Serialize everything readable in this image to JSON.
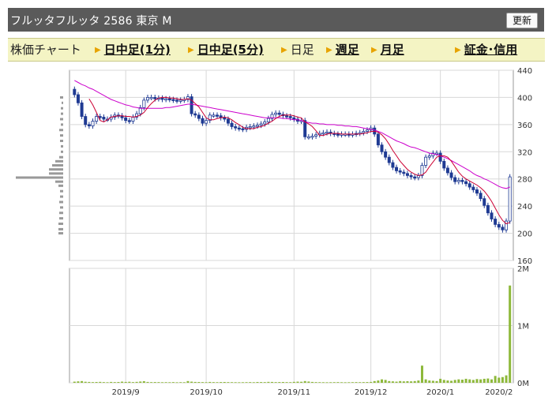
{
  "header": {
    "title": "フルッタフルッタ  2586  東京 M",
    "refresh_label": "更新"
  },
  "tabs": [
    {
      "label": "株価チャート",
      "link": false,
      "arrow": false
    },
    {
      "label": "日中足(1分)",
      "link": true,
      "arrow": true
    },
    {
      "label": "日中足(5分)",
      "link": true,
      "arrow": true
    },
    {
      "label": "日足",
      "link": false,
      "arrow": true
    },
    {
      "label": "週足",
      "link": true,
      "arrow": true
    },
    {
      "label": "月足",
      "link": true,
      "arrow": true
    },
    {
      "label": "証金･信用",
      "link": true,
      "arrow": true
    }
  ],
  "colors": {
    "header_bg": "#5a5a5a",
    "tab_bg": "#f4f4c4",
    "candle": "#1f3a93",
    "ma_short": "#cc0033",
    "ma_long": "#cc00cc",
    "volume": "#8db83a",
    "volume_profile": "#999999"
  },
  "chart_data": [
    {
      "type": "candlestick",
      "title": "",
      "ylim": [
        160,
        440
      ],
      "yticks": [
        160,
        200,
        240,
        280,
        320,
        360,
        400,
        440
      ],
      "x_labels": [
        "2019/9",
        "2019/10",
        "2019/11",
        "2019/12",
        "2020/1",
        "2020/2"
      ],
      "grid": true,
      "close": [
        404,
        392,
        372,
        360,
        358,
        365,
        372,
        371,
        368,
        368,
        371,
        374,
        373,
        370,
        366,
        365,
        371,
        376,
        385,
        396,
        400,
        400,
        398,
        399,
        397,
        398,
        397,
        396,
        395,
        396,
        397,
        401,
        376,
        374,
        369,
        362,
        366,
        374,
        374,
        373,
        370,
        368,
        362,
        357,
        355,
        354,
        353,
        356,
        357,
        358,
        359,
        361,
        364,
        369,
        375,
        377,
        375,
        373,
        372,
        370,
        368,
        365,
        366,
        342,
        342,
        343,
        345,
        347,
        348,
        349,
        347,
        346,
        345,
        346,
        346,
        345,
        346,
        347,
        348,
        350,
        352,
        355,
        346,
        330,
        320,
        312,
        304,
        297,
        292,
        290,
        288,
        285,
        283,
        282,
        285,
        300,
        312,
        314,
        318,
        318,
        306,
        296,
        289,
        282,
        276,
        278,
        276,
        273,
        268,
        264,
        259,
        251,
        241,
        230,
        221,
        213,
        209,
        205,
        218,
        283
      ],
      "ma_short": [
        null,
        null,
        null,
        null,
        398,
        389,
        378,
        366,
        364,
        367,
        371,
        372,
        373,
        373,
        372,
        372,
        371,
        372,
        374,
        378,
        385,
        391,
        396,
        399,
        400,
        400,
        399,
        399,
        398,
        397,
        397,
        398,
        396,
        391,
        386,
        378,
        370,
        367,
        367,
        369,
        370,
        371,
        370,
        367,
        363,
        360,
        356,
        354,
        354,
        354,
        356,
        357,
        359,
        362,
        365,
        369,
        372,
        374,
        374,
        374,
        373,
        371,
        370,
        364,
        361,
        357,
        351,
        344,
        344,
        346,
        347,
        347,
        347,
        346,
        346,
        346,
        346,
        346,
        346,
        347,
        348,
        350,
        350,
        349,
        345,
        339,
        331,
        322,
        314,
        306,
        300,
        294,
        290,
        287,
        285,
        286,
        290,
        298,
        305,
        312,
        314,
        314,
        312,
        306,
        298,
        290,
        284,
        280,
        277,
        274,
        271,
        267,
        262,
        255,
        247,
        237,
        227,
        219,
        214,
        216
      ],
      "ma_long": [
        425,
        422,
        419,
        417,
        414,
        412,
        409,
        406,
        403,
        400,
        397,
        395,
        393,
        391,
        389,
        388,
        386,
        385,
        384,
        384,
        384,
        384,
        384,
        384,
        384,
        385,
        385,
        386,
        387,
        388,
        389,
        390,
        390,
        389,
        388,
        387,
        386,
        385,
        384,
        383,
        382,
        381,
        380,
        379,
        378,
        377,
        376,
        375,
        374,
        373,
        372,
        371,
        370,
        370,
        370,
        370,
        370,
        369,
        369,
        368,
        367,
        367,
        366,
        364,
        363,
        362,
        362,
        361,
        361,
        360,
        360,
        360,
        359,
        359,
        358,
        358,
        357,
        357,
        356,
        355,
        354,
        353,
        352,
        350,
        348,
        345,
        342,
        339,
        336,
        334,
        332,
        329,
        327,
        326,
        324,
        322,
        320,
        318,
        317,
        316,
        314,
        312,
        310,
        307,
        304,
        301,
        298,
        295,
        292,
        288,
        285,
        283,
        280,
        278,
        275,
        272,
        269,
        267,
        266,
        268
      ],
      "volume_profile_note": "horizontal volume-by-price bars at left"
    },
    {
      "type": "bar",
      "title": "",
      "ylim": [
        0,
        2000000
      ],
      "yticks_labels": [
        "0M",
        "1M",
        "2M"
      ],
      "values": [
        20000,
        25000,
        30000,
        18000,
        15000,
        12000,
        14000,
        16000,
        12000,
        10000,
        15000,
        12000,
        14000,
        20000,
        15000,
        18000,
        12000,
        16000,
        22000,
        28000,
        15000,
        12000,
        13000,
        12000,
        10000,
        11000,
        10000,
        12000,
        9000,
        11000,
        10000,
        30000,
        20000,
        15000,
        14000,
        12000,
        10000,
        15000,
        12000,
        11000,
        13000,
        14000,
        12000,
        11000,
        10000,
        9000,
        10000,
        11000,
        12000,
        10000,
        14000,
        13000,
        12000,
        16000,
        15000,
        12000,
        13000,
        14000,
        12000,
        11000,
        16000,
        20000,
        18000,
        30000,
        22000,
        15000,
        12000,
        11000,
        10000,
        9000,
        10000,
        11000,
        12000,
        10000,
        9000,
        10000,
        11000,
        12000,
        11000,
        12000,
        13000,
        15000,
        30000,
        40000,
        60000,
        50000,
        30000,
        25000,
        20000,
        30000,
        25000,
        28000,
        25000,
        30000,
        40000,
        300000,
        60000,
        40000,
        35000,
        30000,
        70000,
        50000,
        40000,
        35000,
        50000,
        60000,
        55000,
        70000,
        60000,
        50000,
        65000,
        60000,
        70000,
        75000,
        60000,
        120000,
        90000,
        100000,
        130000,
        1700000
      ]
    }
  ]
}
